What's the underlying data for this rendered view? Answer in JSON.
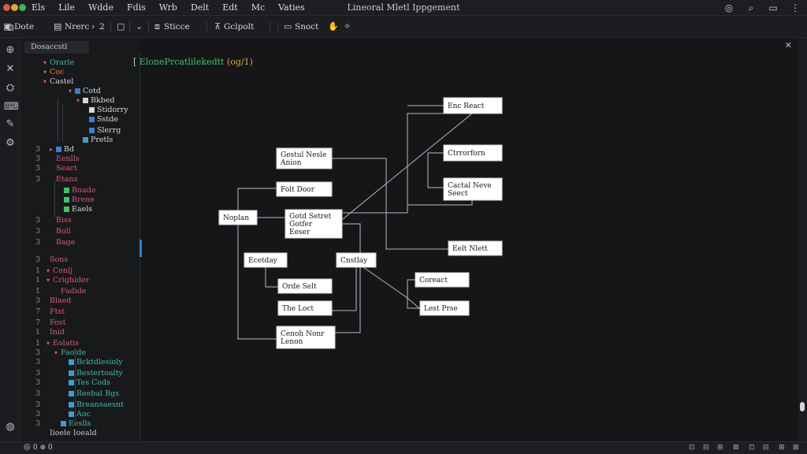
{
  "window": {
    "title": "Lineoral Mletl Ippgement",
    "menus": [
      "Els",
      "Lile",
      "Wdde",
      "Fdis",
      "Wrb",
      "Delt",
      "Edt",
      "Mc",
      "Vaties"
    ]
  },
  "toolbar": {
    "items": [
      {
        "icon": "file-icon",
        "label": "Dote"
      },
      {
        "icon": "document-icon",
        "label": "Nrerc"
      },
      {
        "icon": "chevron-right-icon",
        "label": "2"
      },
      {
        "icon": "square-icon",
        "label": ""
      },
      {
        "icon": "chevron-down-icon",
        "label": ""
      },
      {
        "icon": "box-icon",
        "label": "Sticce"
      },
      {
        "icon": "pin-icon",
        "label": "Gclpolt"
      },
      {
        "icon": "monitor-icon",
        "label": "Snoct"
      },
      {
        "icon": "pointer-icon",
        "label": ""
      },
      {
        "icon": "magic-wand-icon",
        "label": ""
      }
    ]
  },
  "sidebar": {
    "tab_label": "Dosaccstl",
    "rows": [
      {
        "ln": "",
        "tw": "▾",
        "label": "Orarle",
        "color": "#3fb8b8",
        "icon": ""
      },
      {
        "ln": "",
        "tw": "▾",
        "label": "Coc",
        "color": "#e0853a",
        "icon": ""
      },
      {
        "ln": "",
        "tw": "▾",
        "label": "Castel",
        "color": "#d8d8d8",
        "icon": ""
      },
      {
        "ln": "",
        "tw": "▾",
        "label": "Cotd",
        "color": "#d8d8d8",
        "icon": "#3b7fd0",
        "indent": 32
      },
      {
        "ln": "",
        "tw": "▾",
        "label": "Bkbed",
        "color": "#d8d8d8",
        "icon": "#d8d8d8",
        "indent": 42
      },
      {
        "ln": "",
        "tw": "",
        "label": "Stidorry",
        "color": "#d8d8d8",
        "icon": "#d8d8d8",
        "indent": 50
      },
      {
        "ln": "",
        "tw": "",
        "label": "Sstde",
        "color": "#d8d8d8",
        "icon": "#3b7fd0",
        "indent": 50
      },
      {
        "ln": "",
        "tw": "",
        "label": "Slerrg",
        "color": "#d8d8d8",
        "icon": "#3b7fd0",
        "indent": 50
      },
      {
        "ln": "",
        "tw": "",
        "label": "Pretls",
        "color": "#d8d8d8",
        "icon": "#3b9fd0",
        "indent": 42
      },
      {
        "ln": "3",
        "tw": "▸",
        "label": "Bd",
        "color": "#d8d8d8",
        "icon": "#3b7fd0",
        "indent": 8
      },
      {
        "ln": "3",
        "tw": "",
        "label": "Eenlls",
        "color": "#d35a7b",
        "icon": "",
        "indent": 8
      },
      {
        "ln": "3",
        "tw": "",
        "label": "Seact",
        "color": "#d35a7b",
        "icon": "",
        "indent": 8
      },
      {
        "ln": "3",
        "tw": "",
        "label": "Etanz",
        "color": "#d35a7b",
        "icon": "",
        "indent": 8
      },
      {
        "ln": "",
        "tw": "",
        "label": "Bnade",
        "color": "#d35a7b",
        "icon": "#43c06a",
        "indent": 18
      },
      {
        "ln": "",
        "tw": "",
        "label": "Brene",
        "color": "#d35a7b",
        "icon": "#43c06a",
        "indent": 18
      },
      {
        "ln": "",
        "tw": "",
        "label": "Eaels",
        "color": "#d8d8d8",
        "icon": "#43c06a",
        "indent": 18
      },
      {
        "ln": "3",
        "tw": "",
        "label": "Biss",
        "color": "#d35a7b",
        "icon": "",
        "indent": 8
      },
      {
        "ln": "3",
        "tw": "",
        "label": "Boll",
        "color": "#d35a7b",
        "icon": "",
        "indent": 8
      },
      {
        "ln": "3",
        "tw": "",
        "label": "Bage",
        "color": "#d35a7b",
        "icon": "",
        "indent": 8
      },
      {
        "ln": "3",
        "tw": "",
        "label": "Sons",
        "color": "#d35a7b",
        "icon": "",
        "indent": 0
      },
      {
        "ln": "1",
        "tw": "▾",
        "label": "Conlj",
        "color": "#d35a7b",
        "icon": "",
        "indent": 4
      },
      {
        "ln": "1",
        "tw": "▾",
        "label": "Crighider",
        "color": "#d35a7b",
        "icon": "",
        "indent": 4
      },
      {
        "ln": "1",
        "tw": "",
        "label": "Fadide",
        "color": "#d35a7b",
        "icon": "",
        "indent": 14
      },
      {
        "ln": "3",
        "tw": "",
        "label": "Blaed",
        "color": "#d35a7b",
        "icon": "",
        "indent": 0
      },
      {
        "ln": "7",
        "tw": "",
        "label": "Ftst",
        "color": "#d35a7b",
        "icon": "",
        "indent": 0
      },
      {
        "ln": "7",
        "tw": "",
        "label": "Fost",
        "color": "#d35a7b",
        "icon": "",
        "indent": 0
      },
      {
        "ln": "1",
        "tw": "",
        "label": "Inid",
        "color": "#d35a7b",
        "icon": "",
        "indent": 0
      },
      {
        "ln": "1",
        "tw": "▾",
        "label": "Eolatis",
        "color": "#d35a7b",
        "icon": "",
        "indent": 4
      },
      {
        "ln": "3",
        "tw": "▾",
        "label": "Faolde",
        "color": "#3fb8b8",
        "icon": "",
        "indent": 14
      },
      {
        "ln": "3",
        "tw": "",
        "label": "Bcktdlesioly",
        "color": "#3fb8b8",
        "icon": "#3b9fd0",
        "indent": 24
      },
      {
        "ln": "3",
        "tw": "",
        "label": "Bestertoalty",
        "color": "#3fb8b8",
        "icon": "#3b9fd0",
        "indent": 24
      },
      {
        "ln": "3",
        "tw": "",
        "label": "Tes Cods",
        "color": "#3fb8b8",
        "icon": "#3b9fd0",
        "indent": 24
      },
      {
        "ln": "3",
        "tw": "",
        "label": "Reebal Bgs",
        "color": "#3fb8b8",
        "icon": "#3b9fd0",
        "indent": 24
      },
      {
        "ln": "3",
        "tw": "",
        "label": "Breansaesnt",
        "color": "#3fb8b8",
        "icon": "#3b9fd0",
        "indent": 24
      },
      {
        "ln": "3",
        "tw": "",
        "label": "Aoc",
        "color": "#3fb8b8",
        "icon": "#3b9fd0",
        "indent": 24
      },
      {
        "ln": "3",
        "tw": "",
        "label": "Eeslls",
        "color": "#3fb8b8",
        "icon": "#3b9fd0",
        "indent": 14
      },
      {
        "ln": "",
        "tw": "",
        "label": "Iioele  Ioeald",
        "color": "#c3c7ce",
        "icon": "",
        "indent": 0
      }
    ]
  },
  "editor": {
    "code_prefix": "[",
    "code_text": "ElonePrcatlilekedtt",
    "code_paren": "(og/1)",
    "nodes": [
      {
        "id": "n1",
        "lines": [
          "Enc React"
        ]
      },
      {
        "id": "n2",
        "lines": [
          "Ctrrorforn"
        ]
      },
      {
        "id": "n3",
        "lines": [
          "Cactal Neve",
          "Seect"
        ]
      },
      {
        "id": "n4",
        "lines": [
          "Gestul Nesle",
          "Anion"
        ]
      },
      {
        "id": "n5",
        "lines": [
          "Folt Door"
        ]
      },
      {
        "id": "n6",
        "lines": [
          "Noplan"
        ]
      },
      {
        "id": "n7",
        "lines": [
          "Gotd Setret",
          "Gotfer",
          "Eeser"
        ]
      },
      {
        "id": "n8",
        "lines": [
          "Eelt Nlett"
        ]
      },
      {
        "id": "n9",
        "lines": [
          "Ecetday"
        ]
      },
      {
        "id": "n10",
        "lines": [
          "Cnstlay"
        ]
      },
      {
        "id": "n11",
        "lines": [
          "Coreact"
        ]
      },
      {
        "id": "n12",
        "lines": [
          "Orde Selt"
        ]
      },
      {
        "id": "n13",
        "lines": [
          "The Loct"
        ]
      },
      {
        "id": "n14",
        "lines": [
          "Lest Prse"
        ]
      },
      {
        "id": "n15",
        "lines": [
          "Cenoh Nonr",
          "Lenon"
        ]
      }
    ]
  },
  "statusbar": {
    "left": "@ 0 ⊕ 0"
  }
}
